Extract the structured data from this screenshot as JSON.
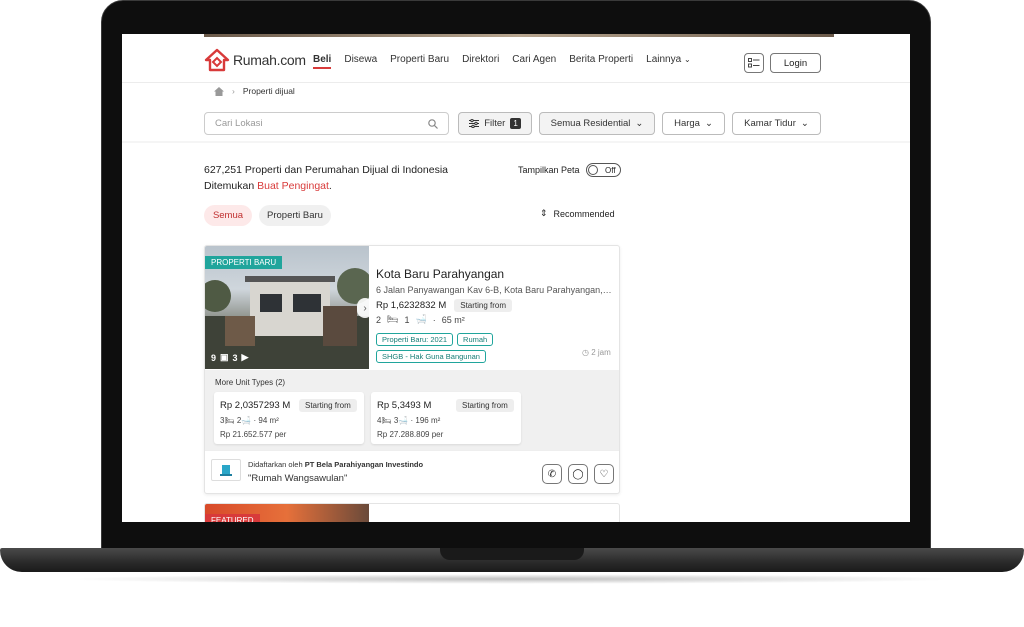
{
  "brand": {
    "logo_text": "Rumah.com",
    "accent": "#d83a3a",
    "teal": "#20a59c"
  },
  "nav": {
    "items": [
      "Beli",
      "Disewa",
      "Properti Baru",
      "Direktori",
      "Cari Agen",
      "Berita Properti",
      "Lainnya"
    ],
    "active": "Beli",
    "login": "Login"
  },
  "breadcrumb": {
    "current": "Properti dijual"
  },
  "filters": {
    "search_placeholder": "Cari Lokasi",
    "filter_label": "Filter",
    "filter_count": "1",
    "type": "Semua Residential",
    "price": "Harga",
    "bedroom": "Kamar Tidur"
  },
  "results": {
    "count_line": "627,251 Properti dan Perumahan Dijual di Indonesia",
    "found_prefix": "Ditemukan ",
    "alert_link": "Buat Pengingat",
    "found_suffix": ".",
    "map_toggle_label": "Tampilkan Peta",
    "map_toggle_state": "Off",
    "chips": [
      "Semua",
      "Properti Baru"
    ],
    "sort": "Recommended"
  },
  "listing": {
    "badge": "PROPERTI BARU",
    "photo_count": "9",
    "video_count": "3",
    "title": "Kota Baru Parahyangan",
    "address": "6 Jalan Panyawangan Kav 6-B, Kota Baru Parahyangan, B...",
    "price": "Rp 1,6232832 M",
    "price_note": "Starting from",
    "beds": "2",
    "baths": "1",
    "area": "65 m²",
    "tags": [
      "Properti Baru: 2021",
      "Rumah",
      "SHGB - Hak Guna Bangunan"
    ],
    "posted": "2 jam",
    "more_units_title": "More Unit Types (2)",
    "units": [
      {
        "price": "Rp 2,0357293 M",
        "note": "Starting from",
        "beds": "3",
        "baths": "2",
        "area": "94 m²",
        "per": "Rp 21.652.577 per"
      },
      {
        "price": "Rp 5,3493 M",
        "note": "Starting from",
        "beds": "4",
        "baths": "3",
        "area": "196 m²",
        "per": "Rp 27.288.809 per"
      }
    ],
    "agent_prefix": "Didaftarkan oleh ",
    "agent_name": "PT Bela Parahiyangan Investindo",
    "project_name": "\"Rumah Wangsawulan\""
  },
  "listing2": {
    "badge": "FEATURED"
  }
}
